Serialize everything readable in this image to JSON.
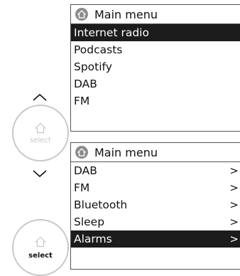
{
  "screen1": {
    "title": "Main menu",
    "items": [
      {
        "label": "Internet radio",
        "selected": true
      },
      {
        "label": "Podcasts",
        "selected": false
      },
      {
        "label": "Spotify",
        "selected": false
      },
      {
        "label": "DAB",
        "selected": false
      },
      {
        "label": "FM",
        "selected": false
      }
    ]
  },
  "screen2": {
    "title": "Main menu",
    "items": [
      {
        "label": "DAB",
        "arrow": ">",
        "selected": false
      },
      {
        "label": "FM",
        "arrow": ">",
        "selected": false
      },
      {
        "label": "Bluetooth",
        "arrow": ">",
        "selected": false
      },
      {
        "label": "Sleep",
        "arrow": ">",
        "selected": false
      },
      {
        "label": "Alarms",
        "arrow": ">",
        "selected": true
      }
    ]
  },
  "knob1": {
    "label": "select",
    "icon": "home-icon"
  },
  "knob2": {
    "label": "select",
    "icon": "home-icon"
  },
  "nav": {
    "up_icon": "chevron-up-icon",
    "down_icon": "chevron-down-icon"
  }
}
